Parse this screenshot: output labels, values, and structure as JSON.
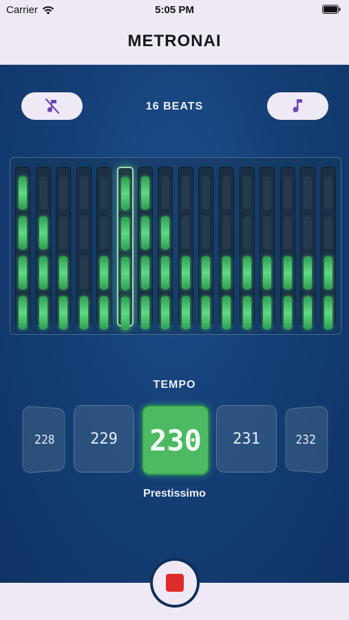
{
  "status_bar": {
    "carrier": "Carrier",
    "time": "5:05 PM"
  },
  "nav": {
    "title": "METRONAI"
  },
  "controls": {
    "beats_label": "16 BEATS",
    "mute_icon": "music-note-off-icon",
    "sound_icon": "music-note-icon"
  },
  "beat_grid": {
    "columns": 16,
    "rows": 4,
    "current_beat_index": 5,
    "levels": [
      4,
      3,
      2,
      1,
      2,
      4,
      4,
      3,
      2,
      2,
      2,
      2,
      2,
      2,
      2,
      2
    ],
    "active_color": "#5fd982"
  },
  "tempo": {
    "label": "TEMPO",
    "values": [
      "228",
      "229",
      "230",
      "231",
      "232"
    ],
    "selected": "230",
    "name": "Prestissimo",
    "selected_color": "#4cba62"
  },
  "playback": {
    "state": "playing",
    "stop_color": "#df2a2a"
  }
}
